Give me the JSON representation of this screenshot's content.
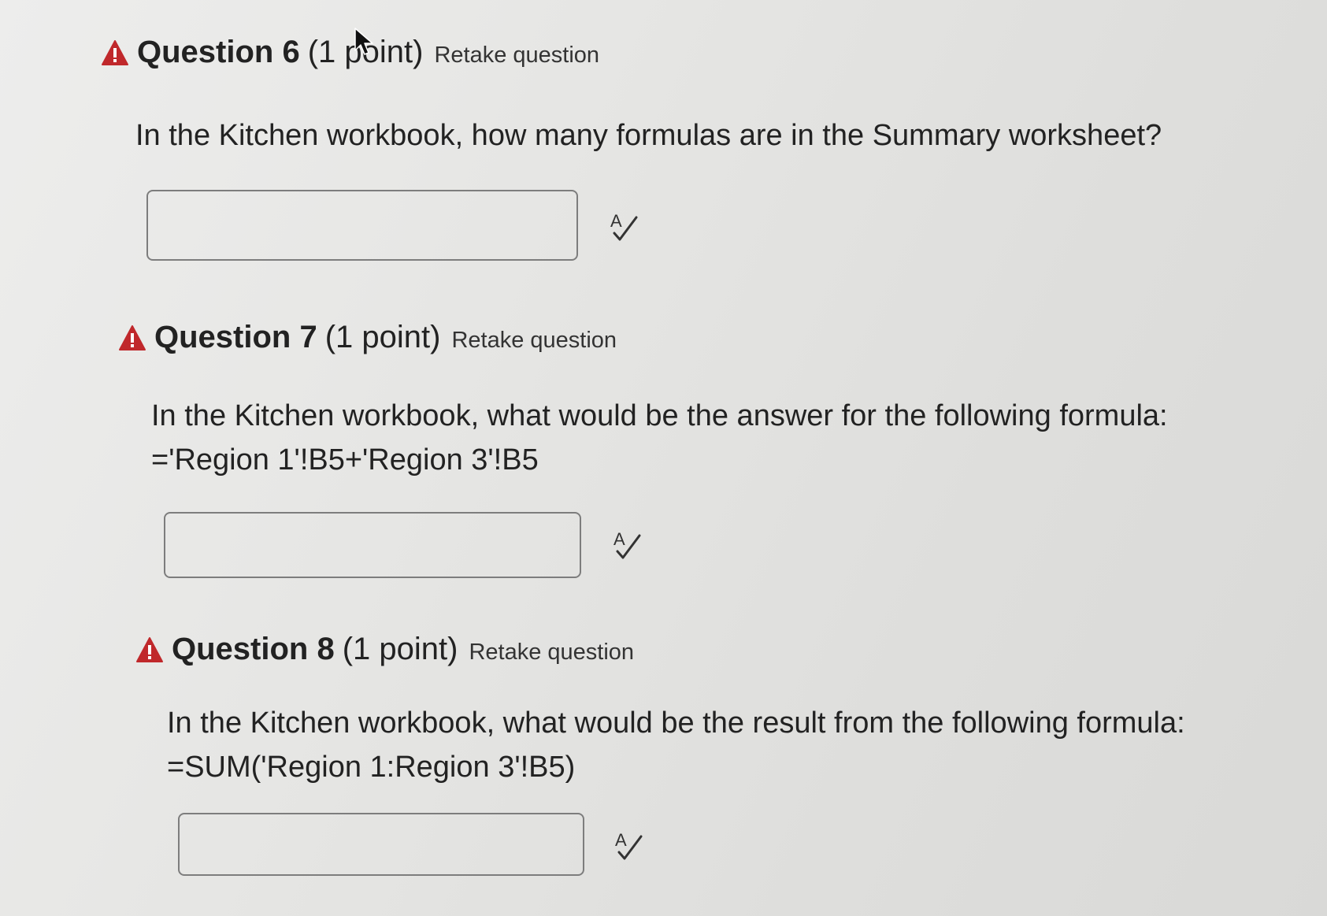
{
  "questions": [
    {
      "title": "Question 6",
      "points": "(1 point)",
      "retake": "Retake question",
      "text_lines": [
        "In the Kitchen workbook, how many formulas are in the Summary worksheet?"
      ],
      "answer_value": ""
    },
    {
      "title": "Question 7",
      "points": "(1 point)",
      "retake": "Retake question",
      "text_lines": [
        "In the Kitchen workbook, what would be the answer for the following formula:",
        "='Region 1'!B5+'Region 3'!B5"
      ],
      "answer_value": ""
    },
    {
      "title": "Question 8",
      "points": "(1 point)",
      "retake": "Retake question",
      "text_lines": [
        "In the Kitchen workbook, what would be the result from the following formula:",
        "=SUM('Region 1:Region 3'!B5)"
      ],
      "answer_value": ""
    }
  ],
  "colors": {
    "warning": "#c0282b",
    "text": "#222222",
    "input_border": "#7d7d7d"
  },
  "icons": {
    "warning": "warning-triangle-icon",
    "spellcheck": "spellcheck-icon",
    "cursor": "mouse-pointer-icon"
  }
}
